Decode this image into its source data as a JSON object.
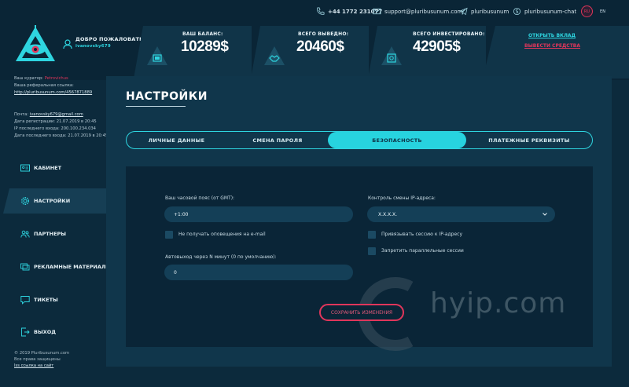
{
  "topbar": {
    "phone": "+44 1772 231077",
    "email": "support@pluribusunum.com",
    "telegram": "pluribusunum",
    "skype": "pluribusunum-chat",
    "lang_ru": "RU",
    "lang_en": "EN"
  },
  "stats": {
    "welcome": "ДОБРО ПОЖАЛОВАТЬ,",
    "username": "ivanovsky679",
    "balance_label": "ВАШ БАЛАНС:",
    "balance_value": "10289$",
    "withdrawn_label": "ВСЕГО ВЫВЕДНО:",
    "withdrawn_value": "20460$",
    "invested_label": "ВСЕГО ИНВЕСТИРОВАНО:",
    "invested_value": "42905$",
    "open_deposit": "ОТКРЫТЬ ВКЛАД",
    "withdraw_funds": "ВЫВЕСТИ СРЕДСТВА"
  },
  "sidebar": {
    "curator_label": "Ваш куратор:",
    "curator_value": "Petrovichus",
    "ref_label": "Ваша реферальная ссылка:",
    "ref_link": "http://pluribusunum.com/4567871889",
    "mail_label": "Почта:",
    "mail_value": "ivanovsky679@gmail.com",
    "reg_label": "Дата регистрации:",
    "reg_value": "21.07.2019 в 20:45",
    "ip_label": "IP последнего входа:",
    "ip_value": "200.100.234.034",
    "last_label": "Дата последнего входа:",
    "last_value": "21.07.2019 в 20:45",
    "items": [
      {
        "label": "КАБИНЕТ"
      },
      {
        "label": "НАСТРОЙКИ"
      },
      {
        "label": "ПАРТНЕРЫ"
      },
      {
        "label": "РЕКЛАМНЫЕ МАТЕРИАЛЫ"
      },
      {
        "label": "ТИКЕТЫ"
      },
      {
        "label": "ВЫХОД"
      }
    ],
    "copyright": "© 2019 Pluribusunum.com",
    "rights": "Все права защищены",
    "made_by": "Iss ссылка на сайт"
  },
  "main": {
    "title": "НАСТРОЙКИ",
    "tabs": [
      {
        "label": "ЛИЧНЫЕ ДАННЫЕ"
      },
      {
        "label": "СМЕНА ПАРОЛЯ"
      },
      {
        "label": "БЕЗОПАСНОСТЬ"
      },
      {
        "label": "ПЛАТЕЖНЫЕ РЕКВИЗИТЫ"
      }
    ],
    "form": {
      "timezone_label": "Ваш часовой пояс (от GMT):",
      "timezone_value": "+1:00",
      "no_notify": "Не получать оповещения на e-mail",
      "autologout_label": "Автовыход через N минут (0 по умолчанию):",
      "autologout_value": "0",
      "ip_control_label": "Контроль смены IP-адреса:",
      "ip_control_value": "X.X.X.X.",
      "bind_session": "Привязывать сессию к IP-адресу",
      "forbid_parallel": "Запретить параллельные сессии",
      "save": "СОХРАНИТЬ ИЗМЕНЕНИЯ"
    }
  },
  "watermark": "hyip.com",
  "colors": {
    "accent": "#27d3df",
    "danger": "#e0365b",
    "bg": "#0c2a3c",
    "panel": "#10364b"
  }
}
